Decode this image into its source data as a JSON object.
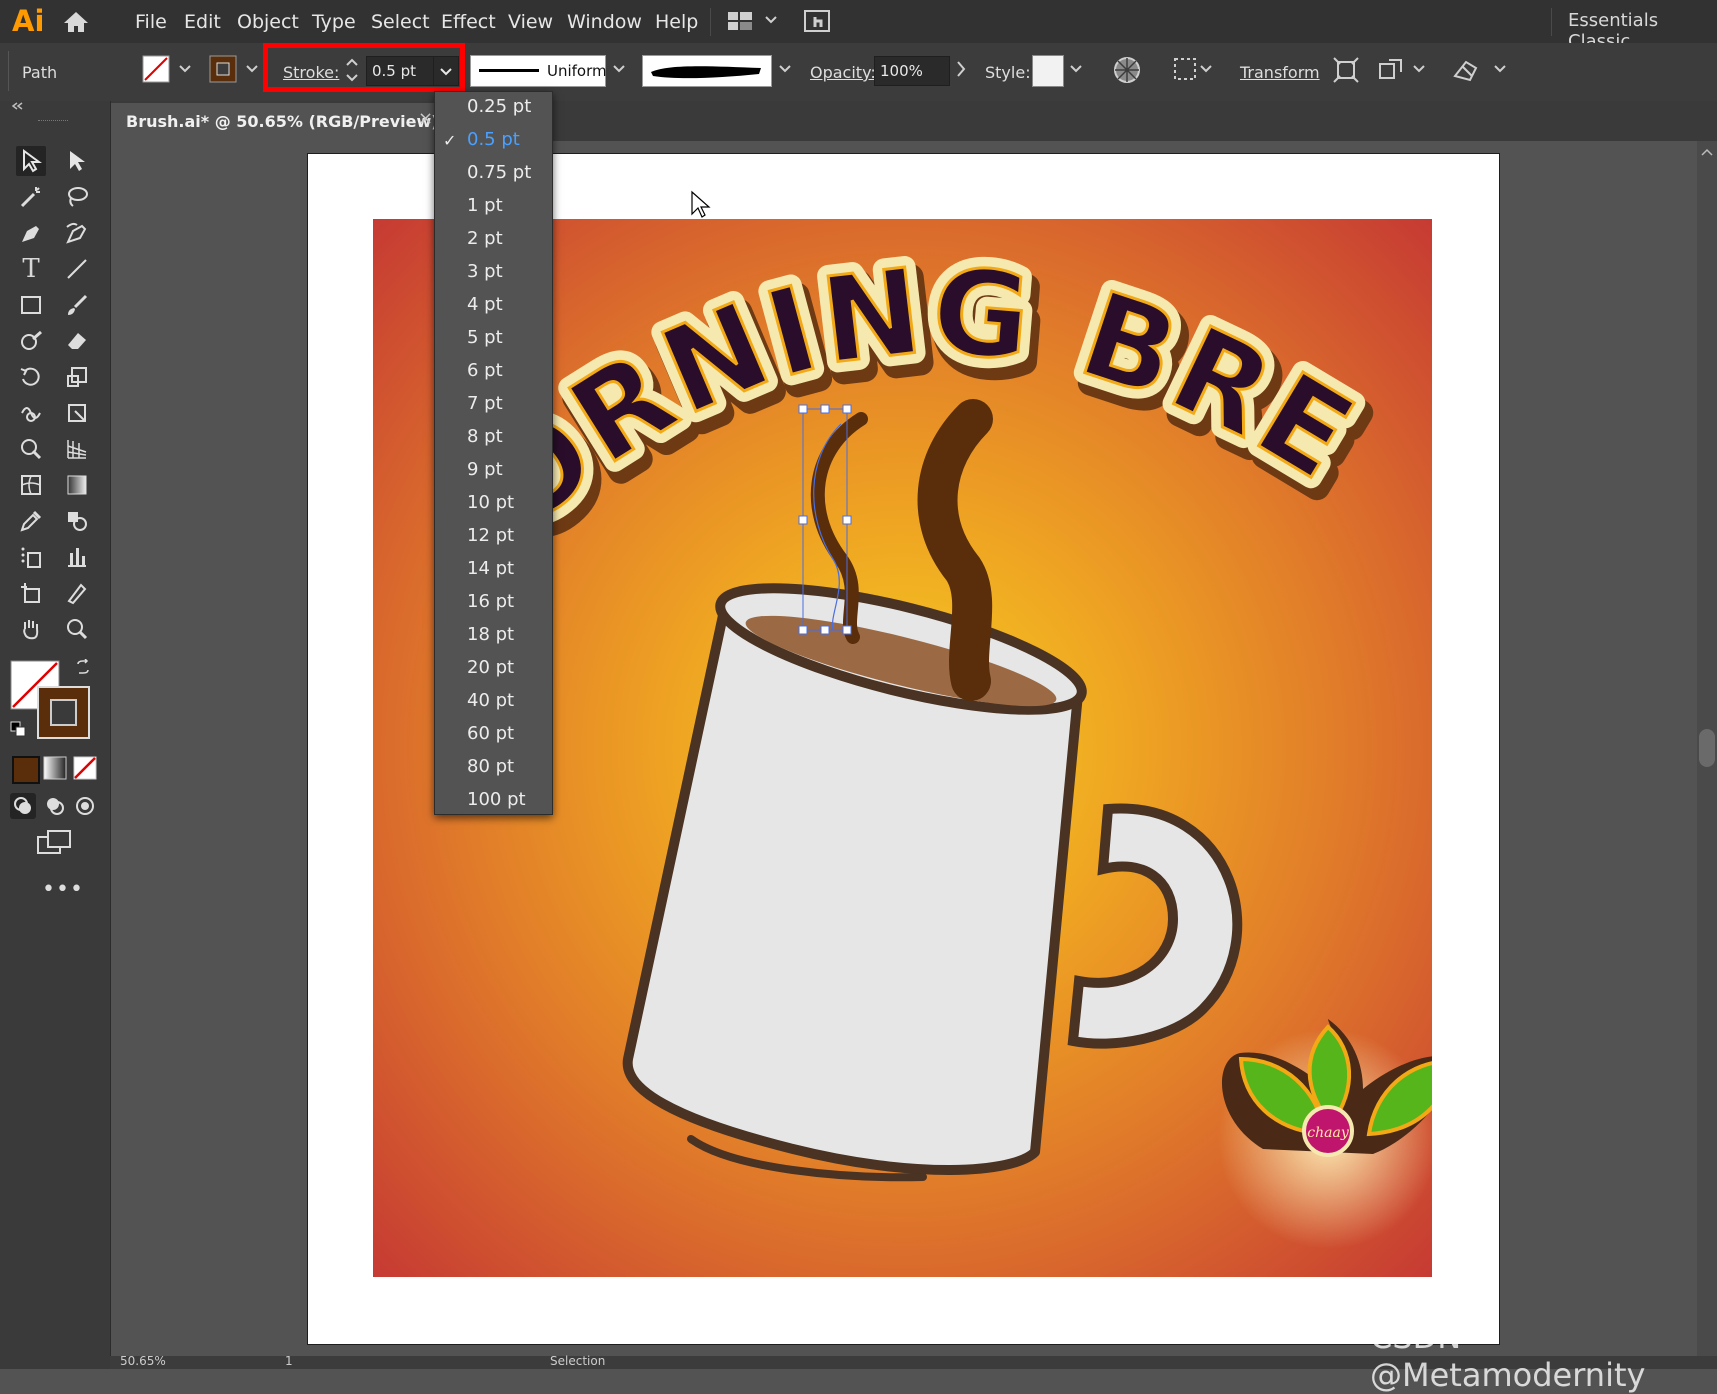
{
  "app": {
    "logo": "Ai",
    "workspace": "Essentials Classic"
  },
  "menu": [
    "File",
    "Edit",
    "Object",
    "Type",
    "Select",
    "Effect",
    "View",
    "Window",
    "Help"
  ],
  "control_bar": {
    "selection_type": "Path",
    "stroke_label": "Stroke:",
    "stroke_value": "0.5 pt",
    "profile": "Uniform",
    "opacity_label": "Opacity:",
    "opacity_value": "100%",
    "style_label": "Style:",
    "transform_label": "Transform"
  },
  "document": {
    "tab_title": "Brush.ai* @ 50.65% (RGB/Preview)",
    "close": "×"
  },
  "stroke_dropdown": {
    "selected": "0.5 pt",
    "options": [
      "0.25 pt",
      "0.5 pt",
      "0.75 pt",
      "1 pt",
      "2 pt",
      "3 pt",
      "4 pt",
      "5 pt",
      "6 pt",
      "7 pt",
      "8 pt",
      "9 pt",
      "10 pt",
      "12 pt",
      "14 pt",
      "16 pt",
      "18 pt",
      "20 pt",
      "40 pt",
      "60 pt",
      "80 pt",
      "100 pt"
    ]
  },
  "artwork": {
    "headline": "MORNING BREW",
    "badge_text": "chaay"
  },
  "status": {
    "zoom": "50.65%",
    "page": "1",
    "mode": "Selection"
  },
  "watermark": "CSDN @Metamodernity",
  "colors": {
    "accent_red": "#ff0000",
    "selected_blue": "#4aa0ff",
    "fill_brown": "#5a2e0a",
    "headline_fill": "#2a0d2a",
    "headline_outline": "#f6e9b0"
  }
}
